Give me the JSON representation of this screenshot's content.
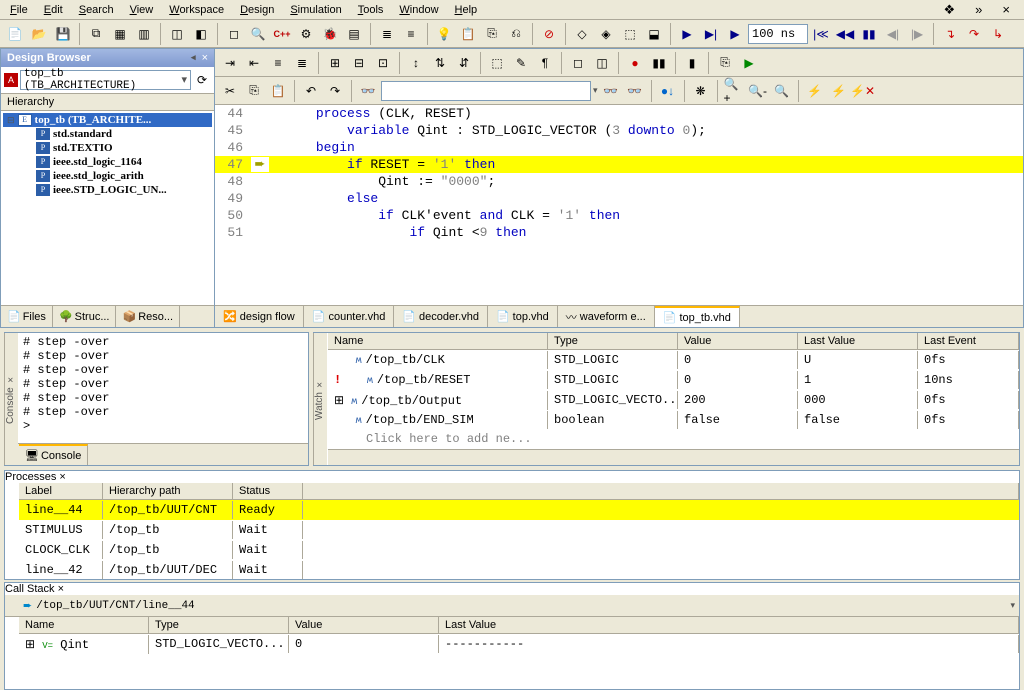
{
  "menu": [
    "File",
    "Edit",
    "Search",
    "View",
    "Workspace",
    "Design",
    "Simulation",
    "Tools",
    "Window",
    "Help"
  ],
  "toolbar": {
    "time": "100 ns"
  },
  "design_browser": {
    "title": "Design Browser",
    "combo": "top_tb (TB_ARCHITECTURE)",
    "hierarchy_label": "Hierarchy",
    "tree": [
      {
        "label": "top_tb (TB_ARCHITE...",
        "icon": "E",
        "sel": true,
        "indent": 0,
        "expand": true
      },
      {
        "label": "std.standard",
        "icon": "P",
        "sel": false,
        "indent": 1
      },
      {
        "label": "std.TEXTIO",
        "icon": "P",
        "sel": false,
        "indent": 1
      },
      {
        "label": "ieee.std_logic_1164",
        "icon": "P",
        "sel": false,
        "indent": 1
      },
      {
        "label": "ieee.std_logic_arith",
        "icon": "P",
        "sel": false,
        "indent": 1
      },
      {
        "label": "ieee.STD_LOGIC_UN...",
        "icon": "P",
        "sel": false,
        "indent": 1
      }
    ],
    "tabs": [
      "Files",
      "Struc...",
      "Reso..."
    ]
  },
  "editor": {
    "search_value": "",
    "tabs": [
      {
        "label": "design flow",
        "active": false,
        "special": true
      },
      {
        "label": "counter.vhd",
        "active": false
      },
      {
        "label": "decoder.vhd",
        "active": false
      },
      {
        "label": "top.vhd",
        "active": false
      },
      {
        "label": "waveform e...",
        "active": false,
        "wave": true
      },
      {
        "label": "top_tb.vhd",
        "active": true
      }
    ]
  },
  "code": {
    "first_line": 44,
    "highlight_line": 47,
    "lines": [
      {
        "n": 44,
        "indent": 3,
        "tokens": [
          {
            "t": "process",
            "c": "kw"
          },
          {
            "t": " (CLK, RESET)"
          }
        ]
      },
      {
        "n": 45,
        "indent": 5,
        "tokens": [
          {
            "t": "variable",
            "c": "kw"
          },
          {
            "t": " Qint : STD_LOGIC_VECTOR ("
          },
          {
            "t": "3",
            "c": "num"
          },
          {
            "t": " "
          },
          {
            "t": "downto",
            "c": "kw"
          },
          {
            "t": " "
          },
          {
            "t": "0",
            "c": "num"
          },
          {
            "t": ");"
          }
        ]
      },
      {
        "n": 46,
        "indent": 3,
        "tokens": [
          {
            "t": "begin",
            "c": "kw"
          }
        ]
      },
      {
        "n": 47,
        "indent": 5,
        "tokens": [
          {
            "t": "if",
            "c": "kw"
          },
          {
            "t": " RESET = "
          },
          {
            "t": "'1'",
            "c": "str"
          },
          {
            "t": " "
          },
          {
            "t": "then",
            "c": "kw"
          }
        ],
        "arrow": true
      },
      {
        "n": 48,
        "indent": 7,
        "tokens": [
          {
            "t": "Qint := "
          },
          {
            "t": "\"0000\"",
            "c": "str"
          },
          {
            "t": ";"
          }
        ]
      },
      {
        "n": 49,
        "indent": 5,
        "tokens": [
          {
            "t": "else",
            "c": "kw"
          }
        ]
      },
      {
        "n": 50,
        "indent": 7,
        "tokens": [
          {
            "t": "if",
            "c": "kw"
          },
          {
            "t": " CLK'event "
          },
          {
            "t": "and",
            "c": "kw"
          },
          {
            "t": " CLK = "
          },
          {
            "t": "'1'",
            "c": "str"
          },
          {
            "t": " "
          },
          {
            "t": "then",
            "c": "kw"
          }
        ]
      },
      {
        "n": 51,
        "indent": 9,
        "tokens": [
          {
            "t": "if",
            "c": "kw"
          },
          {
            "t": " Qint <"
          },
          {
            "t": "9",
            "c": "num"
          },
          {
            "t": " "
          },
          {
            "t": "then",
            "c": "kw"
          }
        ]
      }
    ]
  },
  "console": {
    "tab": "Console",
    "lines": [
      "# step -over",
      "# step -over",
      "# step -over",
      "# step -over",
      "# step -over",
      "# step -over",
      ">"
    ]
  },
  "watch": {
    "columns": [
      "Name",
      "Type",
      "Value",
      "Last Value",
      "Last Event"
    ],
    "rows": [
      {
        "name": "/top_tb/CLK",
        "type": "STD_LOGIC",
        "value": "0",
        "last": "U",
        "event": "0fs",
        "alert": false
      },
      {
        "name": "/top_tb/RESET",
        "type": "STD_LOGIC",
        "value": "0",
        "last": "1",
        "event": "10ns",
        "alert": true
      },
      {
        "name": "/top_tb/Output",
        "type": "STD_LOGIC_VECTO...",
        "value": "200",
        "last": "000",
        "event": "0fs",
        "alert": false,
        "expand": true
      },
      {
        "name": "/top_tb/END_SIM",
        "type": "boolean",
        "value": "false",
        "last": "false",
        "event": "0fs",
        "alert": false
      }
    ],
    "hint": "Click here to add ne..."
  },
  "processes": {
    "columns": [
      "Label",
      "Hierarchy path",
      "Status"
    ],
    "rows": [
      {
        "label": "line__44",
        "path": "/top_tb/UUT/CNT",
        "status": "Ready",
        "sel": true
      },
      {
        "label": "STIMULUS",
        "path": "/top_tb",
        "status": "Wait",
        "sel": false
      },
      {
        "label": "CLOCK_CLK",
        "path": "/top_tb",
        "status": "Wait",
        "sel": false
      },
      {
        "label": "line__42",
        "path": "/top_tb/UUT/DEC",
        "status": "Wait",
        "sel": false
      }
    ]
  },
  "callstack": {
    "path": "/top_tb/UUT/CNT/line__44",
    "columns": [
      "Name",
      "Type",
      "Value",
      "Last Value"
    ],
    "rows": [
      {
        "name": "Qint",
        "type": "STD_LOGIC_VECTO...",
        "value": "0",
        "last": "-----------"
      }
    ]
  }
}
